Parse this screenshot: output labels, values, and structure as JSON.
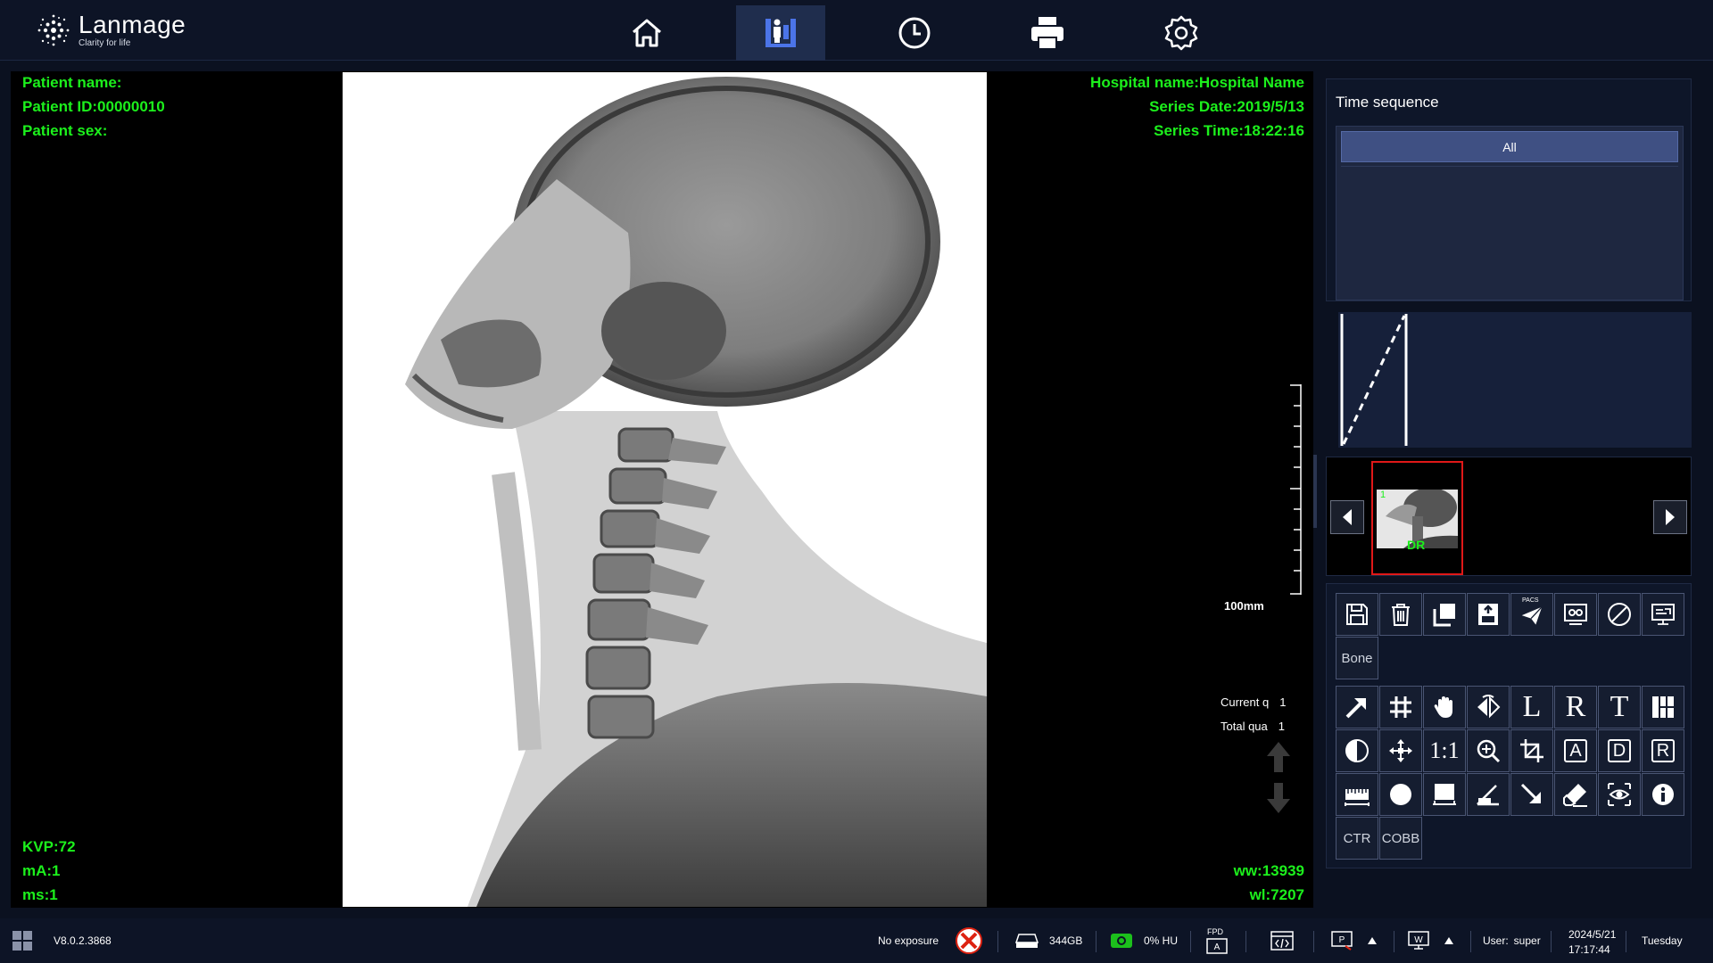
{
  "app": {
    "logo_name": "Lanmage",
    "logo_tagline": "Clarity for life"
  },
  "nav": [
    {
      "name": "home",
      "icon": "home-icon"
    },
    {
      "name": "patient",
      "icon": "patient-icon",
      "active": true
    },
    {
      "name": "history",
      "icon": "clock-icon"
    },
    {
      "name": "print",
      "icon": "printer-icon"
    },
    {
      "name": "settings",
      "icon": "gear-icon"
    }
  ],
  "overlay": {
    "patient_name": "Patient name:",
    "patient_id": "Patient ID:00000010",
    "patient_sex": "Patient sex:",
    "hospital": "Hospital name:Hospital Name",
    "series_date": "Series Date:2019/5/13",
    "series_time": "Series Time:18:22:16",
    "kvp": "KVP:72",
    "ma": "mA:1",
    "ms": "ms:1",
    "ww": "ww:13939",
    "wl": "wl:7207",
    "ruler_label": "100mm",
    "current_q_label": "Current q",
    "current_q_value": "1",
    "total_q_label": "Total qua",
    "total_q_value": "1",
    "color": "#1cf01c"
  },
  "time_sequence": {
    "title": "Time sequence",
    "all_label": "All"
  },
  "thumbnail": {
    "label": "DR",
    "index": "1"
  },
  "tools": {
    "row1": [
      "save-icon",
      "trash-icon",
      "copy-icon",
      "export-icon",
      "pacs-send-icon",
      "image-compare-icon",
      "disable-icon",
      "monitor-icon"
    ],
    "pacs_label": "PACS",
    "bone_label": "Bone",
    "l_label": "L",
    "r_label": "R",
    "t_label": "T",
    "one_to_one": "1:1",
    "a_label": "A",
    "d_label": "D",
    "r_box_label": "R",
    "ctr_label": "CTR",
    "cobb_label": "COBB"
  },
  "status": {
    "version": "V8.0.2.3868",
    "exposure": "No exposure",
    "disk": "344GB",
    "hu": "0% HU",
    "fpd_label": "FPD",
    "user_label": "User:",
    "user": "super",
    "date": "2024/5/21",
    "time": "17:17:44",
    "weekday": "Tuesday"
  }
}
